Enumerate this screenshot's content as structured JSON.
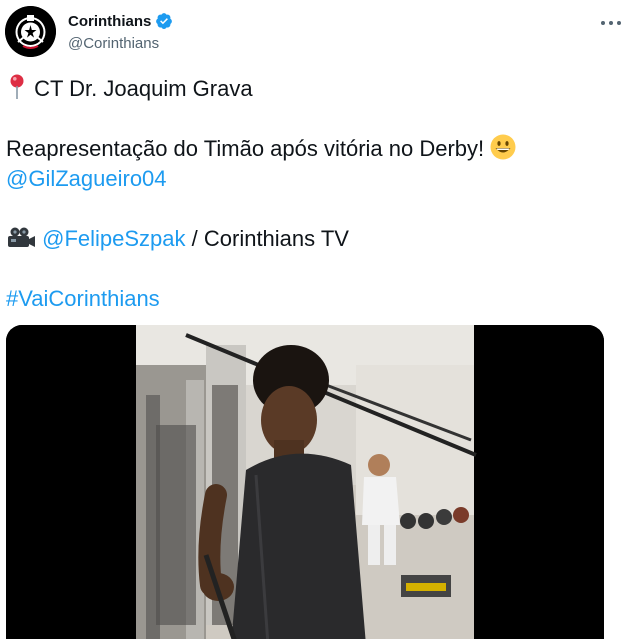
{
  "account": {
    "display_name": "Corinthians",
    "handle": "@Corinthians"
  },
  "tweet": {
    "line1": "CT Dr. Joaquim Grava",
    "line2": "Reapresentação do Timão após vitória no Derby!",
    "mention1": "@GilZagueiro04",
    "mention2": "@FelipeSzpak",
    "credit_suffix": " / Corinthians TV",
    "hashtag": "#VaiCorinthians"
  },
  "icons": {
    "pin": "round-pushpin-icon",
    "smile": "grinning-face-icon",
    "camera": "movie-camera-icon",
    "verified": "verified-badge-icon",
    "more": "more-options-icon"
  },
  "colors": {
    "link": "#1d9bf0",
    "verified": "#1d9bf0",
    "text": "#0f1419",
    "secondary": "#536471"
  }
}
